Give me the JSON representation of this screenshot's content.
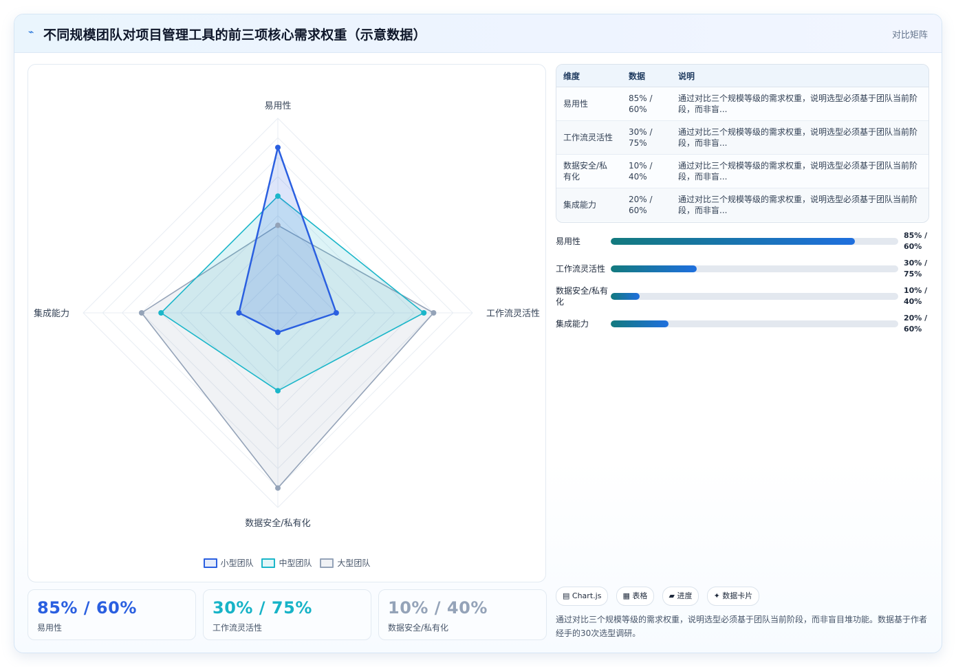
{
  "header": {
    "icon": "⌁",
    "title": "不同规模团队对项目管理工具的前三项核心需求权重（示意数据）",
    "badge": "对比矩阵"
  },
  "chart_data": {
    "type": "radar",
    "axes": [
      "易用性",
      "工作流灵活性",
      "数据安全/私有化",
      "集成能力"
    ],
    "range": [
      0,
      100
    ],
    "grid_levels": 10,
    "series": [
      {
        "name": "小型团队",
        "values": [
          85,
          30,
          10,
          20
        ],
        "color": "#2a5fe0",
        "fill": "rgba(42,95,224,0.16)",
        "stroke_width": 2.5
      },
      {
        "name": "中型团队",
        "values": [
          60,
          75,
          40,
          60
        ],
        "color": "#1bb6c9",
        "fill": "rgba(27,182,201,0.15)",
        "stroke_width": 1.6
      },
      {
        "name": "大型团队",
        "values": [
          45,
          80,
          90,
          70
        ],
        "color": "#94a3b8",
        "fill": "rgba(148,163,184,0.14)",
        "stroke_width": 1.6
      }
    ]
  },
  "kpis": [
    {
      "value": "85% / 60%",
      "label": "易用性",
      "color": "#2a5fe0"
    },
    {
      "value": "30% / 75%",
      "label": "工作流灵活性",
      "color": "#17b3c7"
    },
    {
      "value": "10% / 40%",
      "label": "数据安全/私有化",
      "color": "#94a3b8"
    }
  ],
  "table": {
    "headers": [
      "维度",
      "数据",
      "说明"
    ],
    "rows": [
      [
        "易用性",
        "85% / 60%",
        "通过对比三个规模等级的需求权重，说明选型必须基于团队当前阶段，而非盲..."
      ],
      [
        "工作流灵活性",
        "30% / 75%",
        "通过对比三个规模等级的需求权重，说明选型必须基于团队当前阶段，而非盲..."
      ],
      [
        "数据安全/私有化",
        "10% / 40%",
        "通过对比三个规模等级的需求权重，说明选型必须基于团队当前阶段，而非盲..."
      ],
      [
        "集成能力",
        "20% / 60%",
        "通过对比三个规模等级的需求权重，说明选型必须基于团队当前阶段，而非盲..."
      ]
    ]
  },
  "bars": [
    {
      "label": "易用性",
      "value_text": "85% / 60%",
      "fraction": 0.85
    },
    {
      "label": "工作流灵活性",
      "value_text": "30% / 75%",
      "fraction": 0.3
    },
    {
      "label": "数据安全/私有化",
      "value_text": "10% / 40%",
      "fraction": 0.1
    },
    {
      "label": "集成能力",
      "value_text": "20% / 60%",
      "fraction": 0.2
    }
  ],
  "tags": [
    {
      "icon": "▤",
      "text": "Chart.js"
    },
    {
      "icon": "▦",
      "text": "表格"
    },
    {
      "icon": "▰",
      "text": "进度"
    },
    {
      "icon": "✦",
      "text": "数据卡片"
    }
  ],
  "note": "通过对比三个规模等级的需求权重，说明选型必须基于团队当前阶段，而非盲目堆功能。数据基于作者经手的30次选型调研。"
}
